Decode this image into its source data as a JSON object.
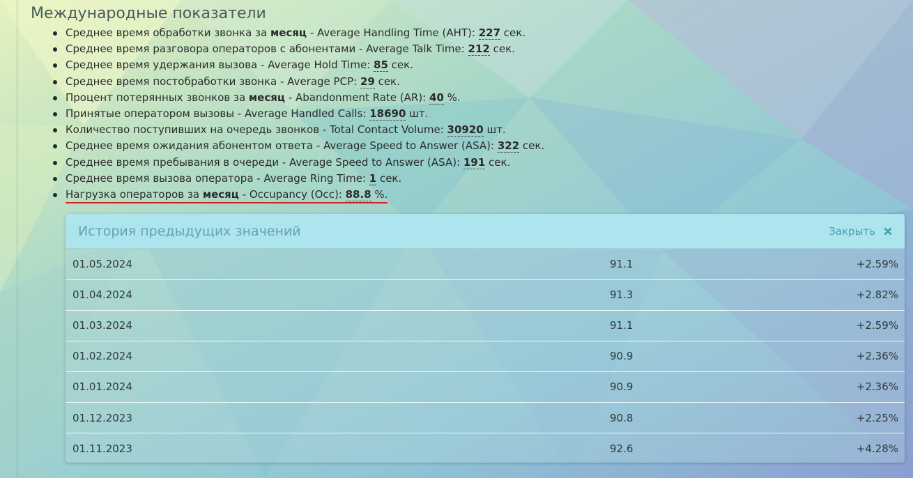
{
  "section": {
    "title": "Международные показатели"
  },
  "metrics": [
    {
      "pre": "Среднее время обработки звонка за ",
      "bold": "месяц",
      "mid": " - Average Handling Time (AHT): ",
      "value": "227",
      "unit": " сек."
    },
    {
      "pre": "Среднее время разговора операторов с абонентами - Average Talk Time: ",
      "bold": "",
      "mid": "",
      "value": "212",
      "unit": " сек."
    },
    {
      "pre": "Среднее время удержания вызова - Average Hold Time: ",
      "bold": "",
      "mid": "",
      "value": "85",
      "unit": " сек."
    },
    {
      "pre": "Среднее время постобработки звонка - Average PCP: ",
      "bold": "",
      "mid": "",
      "value": "29",
      "unit": " сек."
    },
    {
      "pre": "Процент потерянных звонков за ",
      "bold": "месяц",
      "mid": " - Abandonment Rate (AR): ",
      "value": "40",
      "unit": " %."
    },
    {
      "pre": "Принятые оператором вызовы - Average Handled Calls: ",
      "bold": "",
      "mid": "",
      "value": "18690",
      "unit": " шт."
    },
    {
      "pre": "Количество поступивших на очередь звонков - Total Contact Volume: ",
      "bold": "",
      "mid": "",
      "value": "30920",
      "unit": " шт."
    },
    {
      "pre": "Среднее время ожидания абонентом ответа - Average Speed to Answer (ASA): ",
      "bold": "",
      "mid": "",
      "value": "322",
      "unit": " сек."
    },
    {
      "pre": "Среднее время пребывания в очереди - Average Speed to Answer (ASA): ",
      "bold": "",
      "mid": "",
      "value": "191",
      "unit": " сек."
    },
    {
      "pre": "Среднее время вызова оператора - Average Ring Time: ",
      "bold": "",
      "mid": "",
      "value": "1",
      "unit": " сек."
    },
    {
      "pre": "Нагрузка операторов за ",
      "bold": "месяц",
      "mid": " - Occupancy (Occ): ",
      "value": "88.8",
      "unit": " %."
    }
  ],
  "history": {
    "title": "История предыдущих значений",
    "close_label": "Закрыть",
    "close_icon": "close-x-icon",
    "rows": [
      {
        "date": "01.05.2024",
        "value": "91.1",
        "delta": "+2.59%"
      },
      {
        "date": "01.04.2024",
        "value": "91.3",
        "delta": "+2.82%"
      },
      {
        "date": "01.03.2024",
        "value": "91.1",
        "delta": "+2.59%"
      },
      {
        "date": "01.02.2024",
        "value": "90.9",
        "delta": "+2.36%"
      },
      {
        "date": "01.01.2024",
        "value": "90.9",
        "delta": "+2.36%"
      },
      {
        "date": "01.12.2023",
        "value": "90.8",
        "delta": "+2.25%"
      },
      {
        "date": "01.11.2023",
        "value": "92.6",
        "delta": "+4.28%"
      }
    ]
  },
  "colors": {
    "header_bg": "#aee4ee",
    "header_title": "#64a4ae",
    "close_accent": "#3fa3b3",
    "active_underline": "#d42020"
  }
}
